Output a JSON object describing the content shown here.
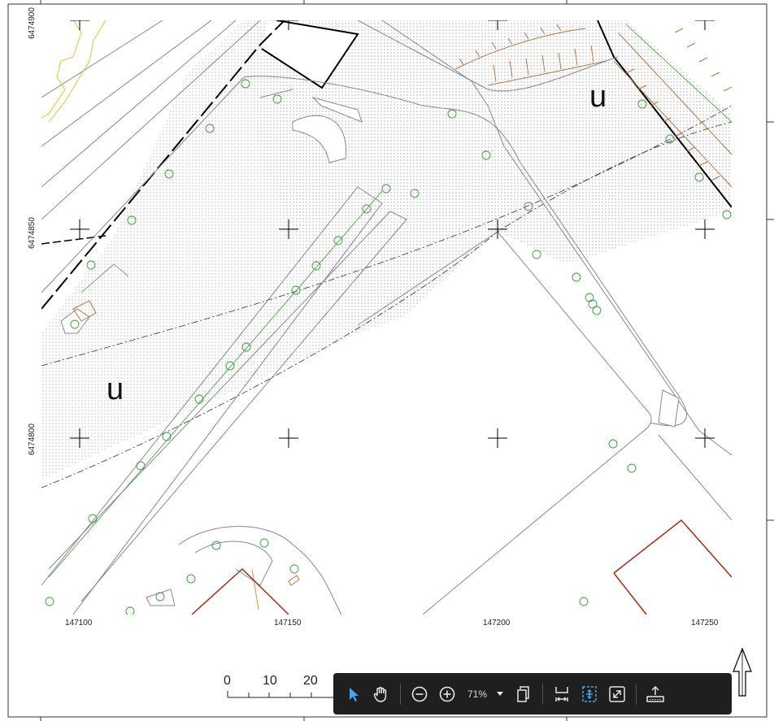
{
  "map": {
    "y_coords": [
      "6474900",
      "6474850",
      "6474800"
    ],
    "x_coords": [
      "147100",
      "147150",
      "147200",
      "147250"
    ],
    "zone_labels": [
      "u",
      "u"
    ],
    "scale_labels": [
      "0",
      "10",
      "20"
    ]
  },
  "toolbar": {
    "zoom_value": "71%",
    "tools": [
      "pointer-icon",
      "hand-icon",
      "zoom-out-icon",
      "zoom-in-icon",
      "copy-icon",
      "fit-width-icon",
      "fit-page-icon",
      "fullscreen-icon",
      "export-icon"
    ],
    "accent": "#4aa3f0"
  },
  "colors": {
    "road_line": "#8c8c8c",
    "building_line": "#000000",
    "tree": "#3a9b3a",
    "brown_hatch": "#b5773f",
    "house": "#9c2d12",
    "yellow_line": "#d4c830"
  }
}
